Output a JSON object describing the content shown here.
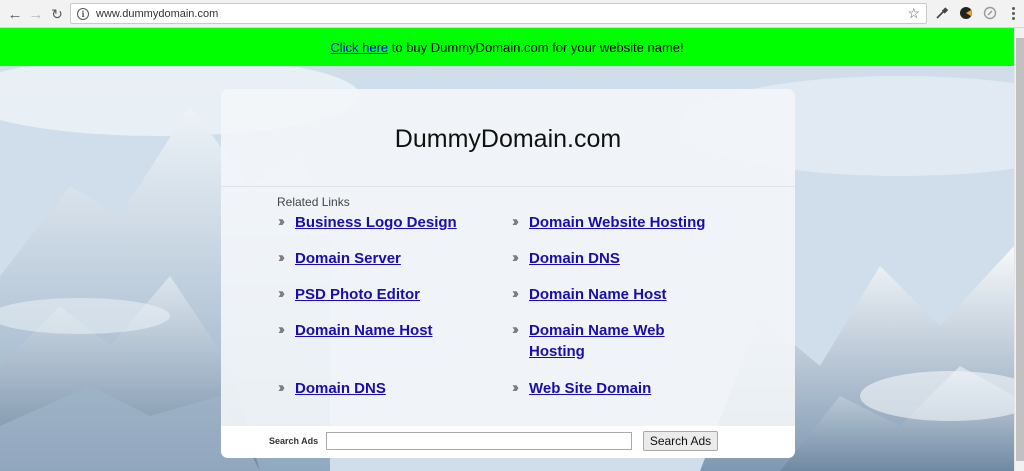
{
  "browser": {
    "url": "www.dummydomain.com",
    "icons": [
      "back-icon",
      "forward-icon",
      "reload-icon",
      "info-icon",
      "star-icon",
      "eyedropper-icon",
      "extension-icon",
      "compass-icon",
      "menu-icon"
    ]
  },
  "banner": {
    "link_text": "Click here",
    "text": " to buy DummyDomain.com for your website name!",
    "background": "#00ff00"
  },
  "page": {
    "title": "DummyDomain.com",
    "related_label": "Related Links",
    "links": [
      {
        "label": "Business Logo Design"
      },
      {
        "label": "Domain Website Hosting"
      },
      {
        "label": "Domain Server"
      },
      {
        "label": "Domain DNS"
      },
      {
        "label": "PSD Photo Editor"
      },
      {
        "label": "Domain Name Host"
      },
      {
        "label": "Domain Name Host"
      },
      {
        "label": "Domain Name Web Hosting"
      },
      {
        "label": "Domain DNS"
      },
      {
        "label": "Web Site Domain"
      }
    ]
  },
  "search": {
    "label": "Search Ads",
    "value": "",
    "button": "Search Ads"
  },
  "colors": {
    "link": "#1a0dab",
    "chevron": "#777777"
  }
}
